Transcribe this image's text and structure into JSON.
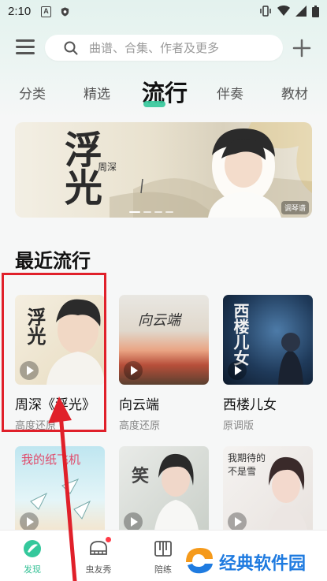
{
  "status_bar": {
    "time": "2:10",
    "a_icon": "A"
  },
  "search": {
    "placeholder": "曲谱、合集、作者及更多"
  },
  "tabs": [
    {
      "label": "分类"
    },
    {
      "label": "精选"
    },
    {
      "label": "流行"
    },
    {
      "label": "伴奏"
    },
    {
      "label": "教材"
    }
  ],
  "banner": {
    "title": "浮光",
    "artist": "周深",
    "badge": "调琴谱"
  },
  "section": {
    "title": "最近流行"
  },
  "cards": [
    {
      "title": "周深《浮光》",
      "subtitle": "高度还原",
      "cover_text": "浮光"
    },
    {
      "title": "向云端",
      "subtitle": "高度还原",
      "cover_text": "向云端"
    },
    {
      "title": "西楼儿女",
      "subtitle": "原调版",
      "cover_text": "西楼儿女"
    },
    {
      "cover_text": "我的纸飞机"
    },
    {
      "cover_text": "笑"
    },
    {
      "cover_text": "我期待的不是雪"
    }
  ],
  "bottom_nav": [
    {
      "label": "发现"
    },
    {
      "label": "虫友秀"
    },
    {
      "label": "陪练"
    }
  ],
  "watermark": {
    "text": "经典软件园"
  },
  "colors": {
    "accent": "#2fbf93",
    "highlight": "#e0202a"
  }
}
